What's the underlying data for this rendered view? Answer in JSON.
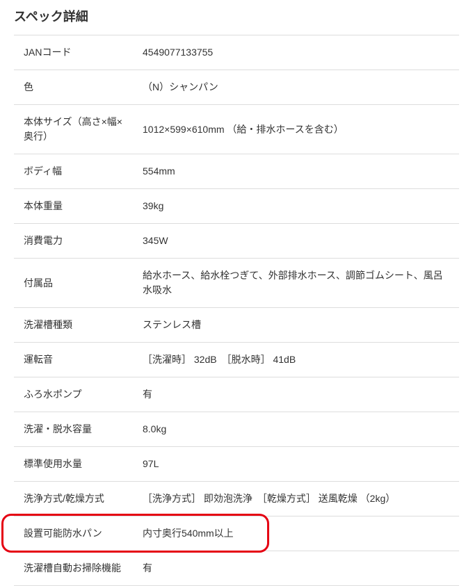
{
  "title": "スペック詳細",
  "rows": [
    {
      "label": "JANコード",
      "value": "4549077133755"
    },
    {
      "label": "色",
      "value": "（N）シャンパン"
    },
    {
      "label": "本体サイズ（高さ×幅×奥行）",
      "value": "1012×599×610mm （給・排水ホースを含む）"
    },
    {
      "label": "ボディ幅",
      "value": "554mm"
    },
    {
      "label": "本体重量",
      "value": "39kg"
    },
    {
      "label": "消費電力",
      "value": "345W"
    },
    {
      "label": "付属品",
      "value": "給水ホース、給水栓つぎて、外部排水ホース、調節ゴムシート、風呂水吸水"
    },
    {
      "label": "洗濯槽種類",
      "value": "ステンレス槽"
    },
    {
      "label": "運転音",
      "value": "［洗濯時］ 32dB　［脱水時］ 41dB"
    },
    {
      "label": "ふろ水ポンプ",
      "value": "有"
    },
    {
      "label": "洗濯・脱水容量",
      "value": "8.0kg"
    },
    {
      "label": "標準使用水量",
      "value": "97L"
    },
    {
      "label": "洗浄方式/乾燥方式",
      "value": "［洗浄方式］ 即効泡洗浄　［乾燥方式］ 送風乾燥 （2kg）"
    },
    {
      "label": "設置可能防水パン",
      "value": "内寸奥行540mm以上"
    },
    {
      "label": "洗濯槽自動お掃除機能",
      "value": "有"
    }
  ],
  "highlight_row_index": 13
}
